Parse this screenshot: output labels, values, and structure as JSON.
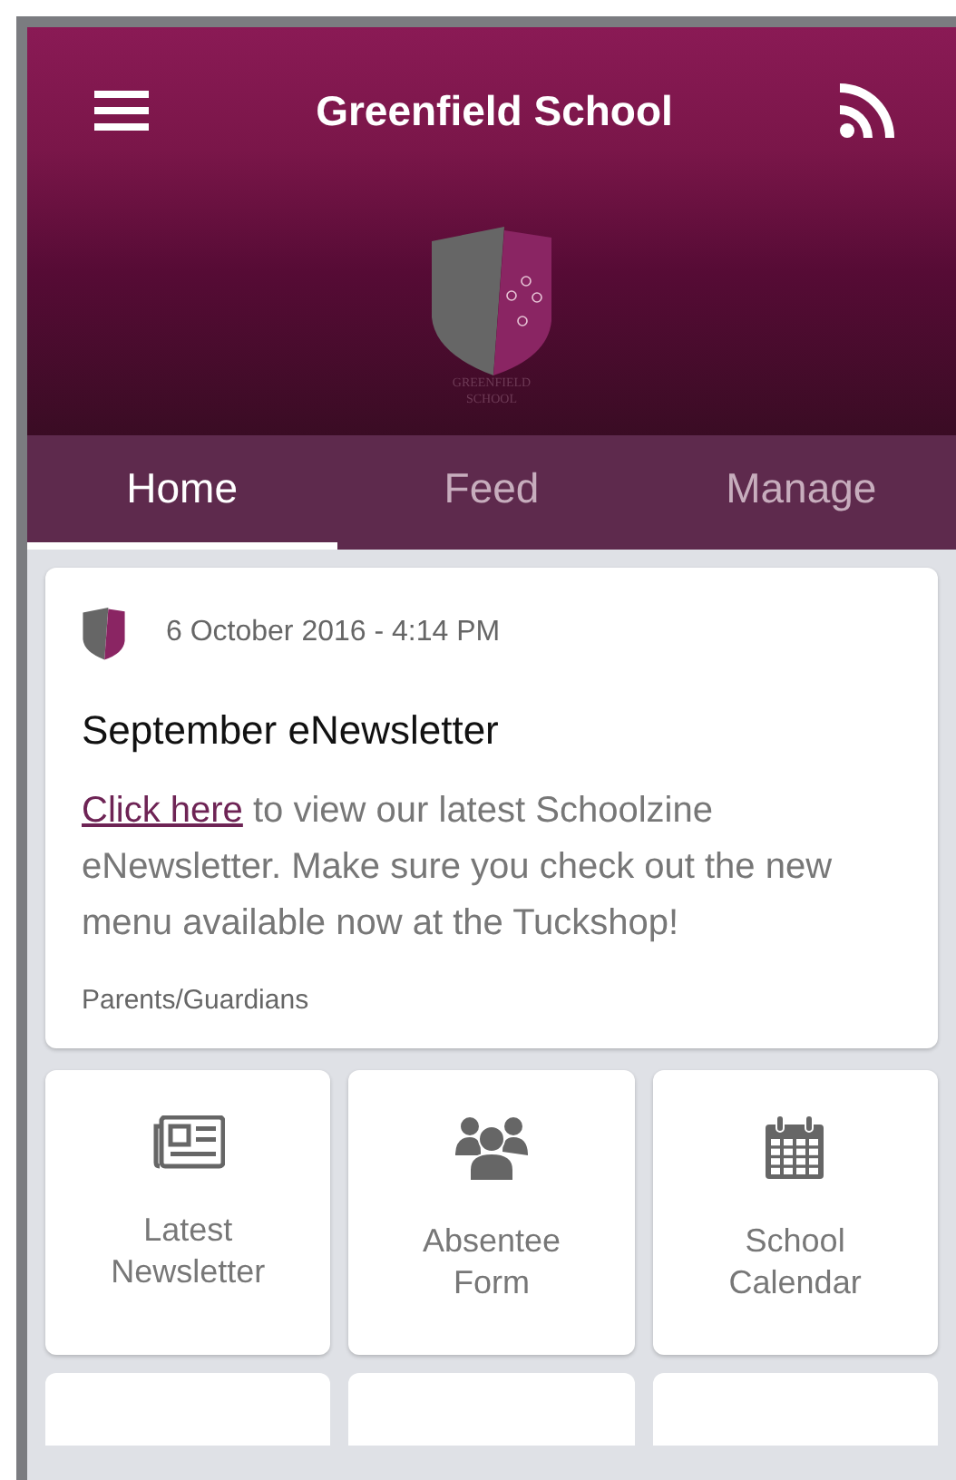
{
  "header": {
    "title": "Greenfield School",
    "crest_text": [
      "GREENFIELD",
      "SCHOOL"
    ]
  },
  "tabs": [
    {
      "label": "Home",
      "selected": true
    },
    {
      "label": "Feed",
      "selected": false
    },
    {
      "label": "Manage",
      "selected": false
    }
  ],
  "post": {
    "date": "6 October 2016 - 4:14 PM",
    "title": "September eNewsletter",
    "link": "Click here",
    "body": " to view our latest Schoolzine eNewsletter. Make sure you check out the new menu available now at the Tuckshop!",
    "audience": "Parents/Guardians"
  },
  "tiles": [
    {
      "label": "Latest Newsletter"
    },
    {
      "label": "Absentee Form"
    },
    {
      "label": "School Calendar"
    }
  ]
}
